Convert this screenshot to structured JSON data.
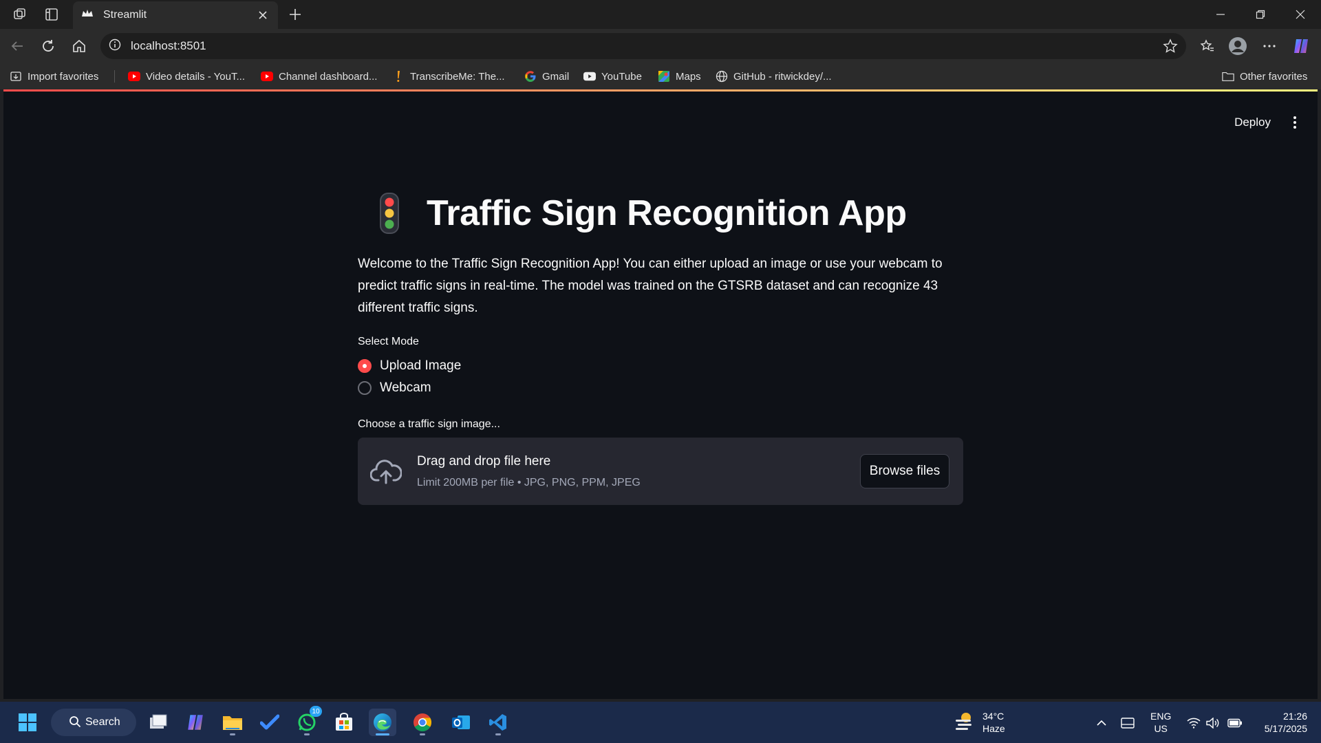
{
  "browser": {
    "tab_title": "Streamlit",
    "address": "localhost:8501",
    "bookmarks": [
      {
        "label": "Import favorites",
        "icon": "import-icon"
      },
      {
        "label": "Video details - YouT...",
        "icon": "youtube-icon"
      },
      {
        "label": "Channel dashboard...",
        "icon": "youtube-icon"
      },
      {
        "label": "TranscribeMe: The...",
        "icon": "exclamation-icon"
      },
      {
        "label": "Gmail",
        "icon": "google-icon"
      },
      {
        "label": "YouTube",
        "icon": "youtube-icon"
      },
      {
        "label": "Maps",
        "icon": "maps-icon"
      },
      {
        "label": "GitHub - ritwickdey/...",
        "icon": "globe-icon"
      },
      {
        "label": "Other favorites",
        "icon": "folder-icon"
      }
    ]
  },
  "app": {
    "deploy_label": "Deploy",
    "title": "Traffic Sign Recognition App",
    "intro": "Welcome to the Traffic Sign Recognition App! You can either upload an image or use your webcam to predict traffic signs in real-time. The model was trained on the GTSRB dataset and can recognize 43 different traffic signs.",
    "mode_label": "Select Mode",
    "modes": [
      {
        "label": "Upload Image",
        "selected": true
      },
      {
        "label": "Webcam",
        "selected": false
      }
    ],
    "uploader": {
      "label": "Choose a traffic sign image...",
      "title": "Drag and drop file here",
      "subtitle": "Limit 200MB per file • JPG, PNG, PPM, JPEG",
      "button": "Browse files"
    },
    "colors": {
      "accent": "#ff4b4b",
      "background": "#0e1117",
      "panel": "#262730"
    }
  },
  "taskbar": {
    "search_label": "Search",
    "whatsapp_badge": "10",
    "weather": {
      "temp": "34°C",
      "condition": "Haze"
    },
    "lang": {
      "line1": "ENG",
      "line2": "US"
    },
    "clock": {
      "time": "21:26",
      "date": "5/17/2025"
    }
  }
}
